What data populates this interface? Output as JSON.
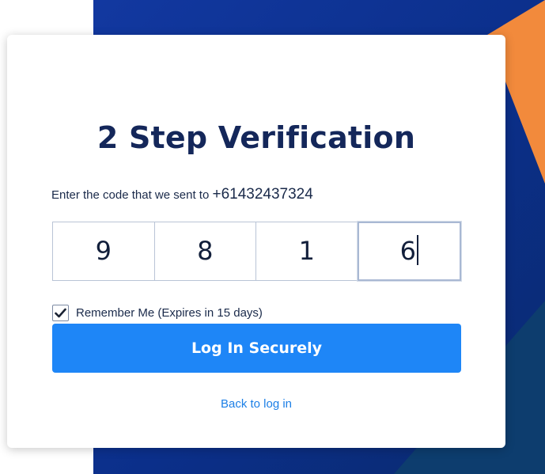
{
  "colors": {
    "navy": "#0b2f8a",
    "navy_dark": "#0a2a6e",
    "orange": "#f28a3c",
    "accent_blue": "#1e86f7",
    "title_navy": "#14275a",
    "link_blue": "#1c7fe6"
  },
  "page": {
    "title": "2 Step Verification"
  },
  "instructions": {
    "text": "Enter the code that we sent to",
    "phone": "+61432437324"
  },
  "code": {
    "digits": [
      "9",
      "8",
      "1",
      "6"
    ]
  },
  "remember": {
    "label": "Remember Me (Expires in 15 days)",
    "checked": true,
    "icon": "checkmark-icon"
  },
  "actions": {
    "login_label": "Log In Securely",
    "back_label": "Back to log in"
  }
}
